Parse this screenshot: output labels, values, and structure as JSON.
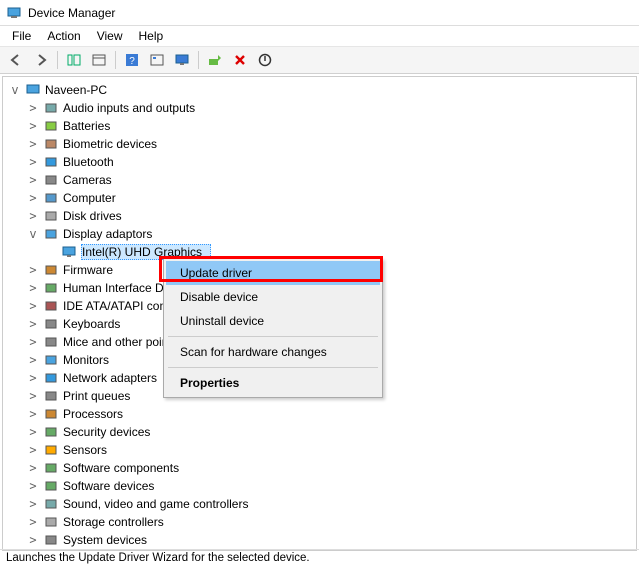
{
  "window": {
    "title": "Device Manager"
  },
  "menu": {
    "file": "File",
    "action": "Action",
    "view": "View",
    "help": "Help"
  },
  "toolbar": {
    "back": "back-icon",
    "forward": "forward-icon",
    "showhide": "showhide-icon",
    "allDevices": "all-devices-icon",
    "help": "help-icon",
    "refresh": "refresh-icon",
    "monitor": "monitor-icon",
    "updateDriver": "update-driver-icon",
    "disable": "disable-device-icon",
    "uninstall": "uninstall-device-icon"
  },
  "root": {
    "label": "Naveen-PC"
  },
  "categories": [
    {
      "label": "Audio inputs and outputs"
    },
    {
      "label": "Batteries"
    },
    {
      "label": "Biometric devices"
    },
    {
      "label": "Bluetooth"
    },
    {
      "label": "Cameras"
    },
    {
      "label": "Computer"
    },
    {
      "label": "Disk drives"
    },
    {
      "expanded": true,
      "label": "Display adaptors",
      "selectedChild": {
        "label": "Intel(R) UHD Graphics"
      }
    },
    {
      "label": "Firmware"
    },
    {
      "label": "Human Interface Devices"
    },
    {
      "label": "IDE ATA/ATAPI controllers"
    },
    {
      "label": "Keyboards"
    },
    {
      "label": "Mice and other pointing devices"
    },
    {
      "label": "Monitors"
    },
    {
      "label": "Network adapters"
    },
    {
      "label": "Print queues"
    },
    {
      "label": "Processors"
    },
    {
      "label": "Security devices"
    },
    {
      "label": "Sensors"
    },
    {
      "label": "Software components"
    },
    {
      "label": "Software devices"
    },
    {
      "label": "Sound, video and game controllers"
    },
    {
      "label": "Storage controllers"
    },
    {
      "label": "System devices"
    }
  ],
  "contextMenu": {
    "update": "Update driver",
    "disable": "Disable device",
    "uninstall": "Uninstall device",
    "scan": "Scan for hardware changes",
    "properties": "Properties"
  },
  "status": "Launches the Update Driver Wizard for the selected device.",
  "icons": {
    "pc": "pc-icon",
    "audio": "speaker-icon",
    "battery": "battery-icon",
    "biometric": "fingerprint-icon",
    "bluetooth": "bluetooth-icon",
    "camera": "camera-icon",
    "computer": "computer-tower-icon",
    "disk": "disk-drive-icon",
    "display": "monitor-icon",
    "firmware": "chip-icon",
    "hid": "hid-icon",
    "ide": "ide-controller-icon",
    "keyboard": "keyboard-icon",
    "mouse": "mouse-icon",
    "monitor": "monitor-device-icon",
    "network": "network-adapter-icon",
    "printer": "printer-icon",
    "processor": "processor-icon",
    "security": "security-device-icon",
    "sensor": "sensor-icon",
    "swcomp": "software-component-icon",
    "swdev": "software-device-icon",
    "sound": "sound-controller-icon",
    "storage": "storage-controller-icon",
    "system": "system-device-icon"
  }
}
